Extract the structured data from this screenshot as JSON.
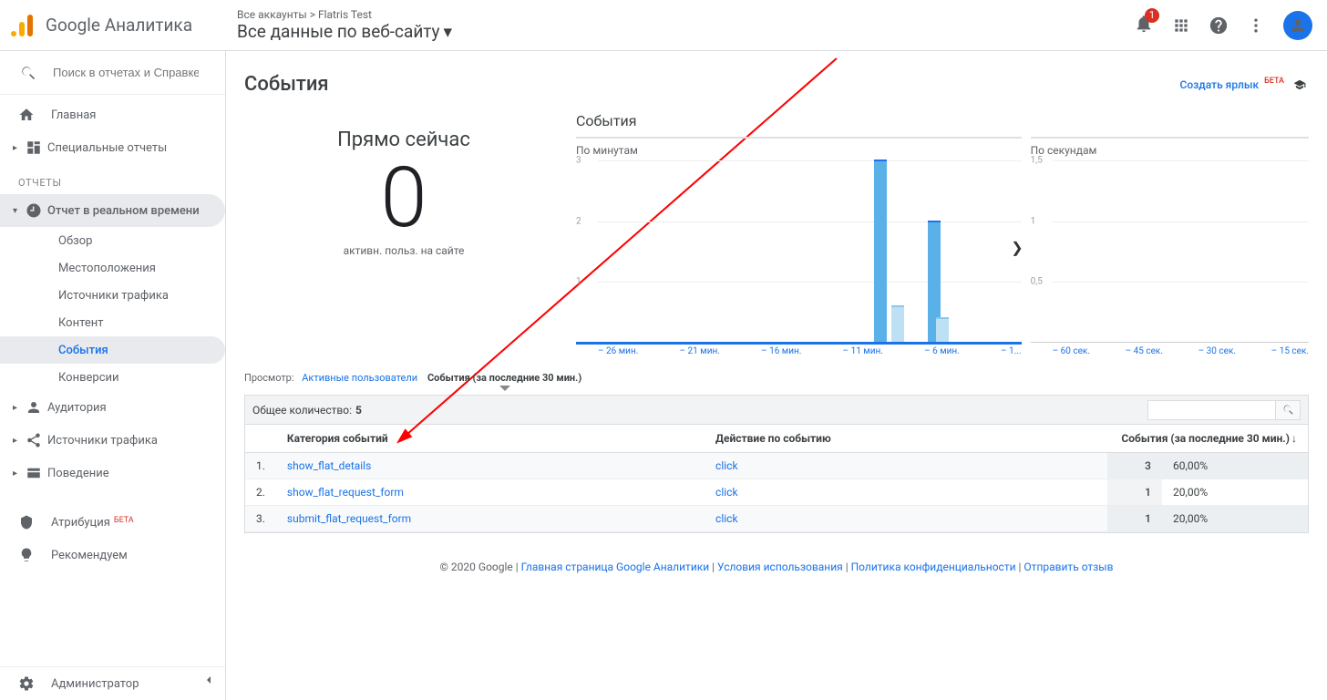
{
  "header": {
    "product": "Google Аналитика",
    "breadcrumb_parent": "Все аккаунты",
    "breadcrumb_sep": " > ",
    "breadcrumb_child": "Flatris Test",
    "property_title": "Все данные по веб-сайту",
    "notification_count": "1"
  },
  "sidebar": {
    "search_placeholder": "Поиск в отчетах и Справке",
    "home": "Главная",
    "custom_reports": "Специальные отчеты",
    "section_reports": "ОТЧЕТЫ",
    "realtime": "Отчет в реальном времени",
    "realtime_children": {
      "overview": "Обзор",
      "locations": "Местоположения",
      "traffic": "Источники трафика",
      "content": "Контент",
      "events": "События",
      "conversions": "Конверсии"
    },
    "audience": "Аудитория",
    "acquisition": "Источники трафика",
    "behavior": "Поведение",
    "attribution": "Атрибуция",
    "attribution_beta": "БЕТА",
    "discover": "Рекомендуем",
    "admin": "Администратор"
  },
  "page": {
    "title": "События",
    "shortcut_link": "Создать ярлык",
    "shortcut_beta": "БЕТА"
  },
  "now": {
    "label": "Прямо сейчас",
    "value": "0",
    "sub": "активн. польз. на сайте"
  },
  "charts_title": "События",
  "chart_min_label": "По минутам",
  "chart_sec_label": "По секундам",
  "chart_data": [
    {
      "type": "bar",
      "title": "По минутам",
      "ylim": [
        0,
        3
      ],
      "yticks": [
        1,
        2,
        3
      ],
      "xticks": [
        "– 26 мин.",
        "– 21 мин.",
        "– 16 мин.",
        "– 11 мин.",
        "– 6 мин.",
        "– 1..."
      ],
      "bars": [
        {
          "x_pct": 62,
          "value": 3,
          "fade": false
        },
        {
          "x_pct": 66,
          "value": 0.6,
          "fade": true
        },
        {
          "x_pct": 74,
          "value": 2,
          "fade": false
        },
        {
          "x_pct": 76,
          "value": 0.4,
          "fade": true
        }
      ]
    },
    {
      "type": "bar",
      "title": "По секундам",
      "ylim": [
        0,
        1.5
      ],
      "yticks": [
        0.5,
        1,
        1.5
      ],
      "ytick_labels": [
        "0,5",
        "1",
        "1,5"
      ],
      "xticks": [
        "– 60 сек.",
        "– 45 сек.",
        "– 30 сек.",
        "– 15 сек."
      ],
      "bars": []
    }
  ],
  "view_tabs": {
    "label": "Просмотр:",
    "tab_active_users": "Активные пользователи",
    "tab_events": "События (за последние 30 мин.)"
  },
  "table": {
    "total_label": "Общее количество:",
    "total_value": "5",
    "col_category": "Категория событий",
    "col_action": "Действие по событию",
    "col_events": "События (за последние 30 мин.)",
    "rows": [
      {
        "idx": "1.",
        "category": "show_flat_details",
        "action": "click",
        "count": "3",
        "pct": "60,00%"
      },
      {
        "idx": "2.",
        "category": "show_flat_request_form",
        "action": "click",
        "count": "1",
        "pct": "20,00%"
      },
      {
        "idx": "3.",
        "category": "submit_flat_request_form",
        "action": "click",
        "count": "1",
        "pct": "20,00%"
      }
    ]
  },
  "footer": {
    "copyright": "© 2020 Google",
    "links": {
      "home": "Главная страница Google Аналитики",
      "terms": "Условия использования",
      "privacy": "Политика конфиденциальности",
      "feedback": "Отправить отзыв"
    }
  }
}
